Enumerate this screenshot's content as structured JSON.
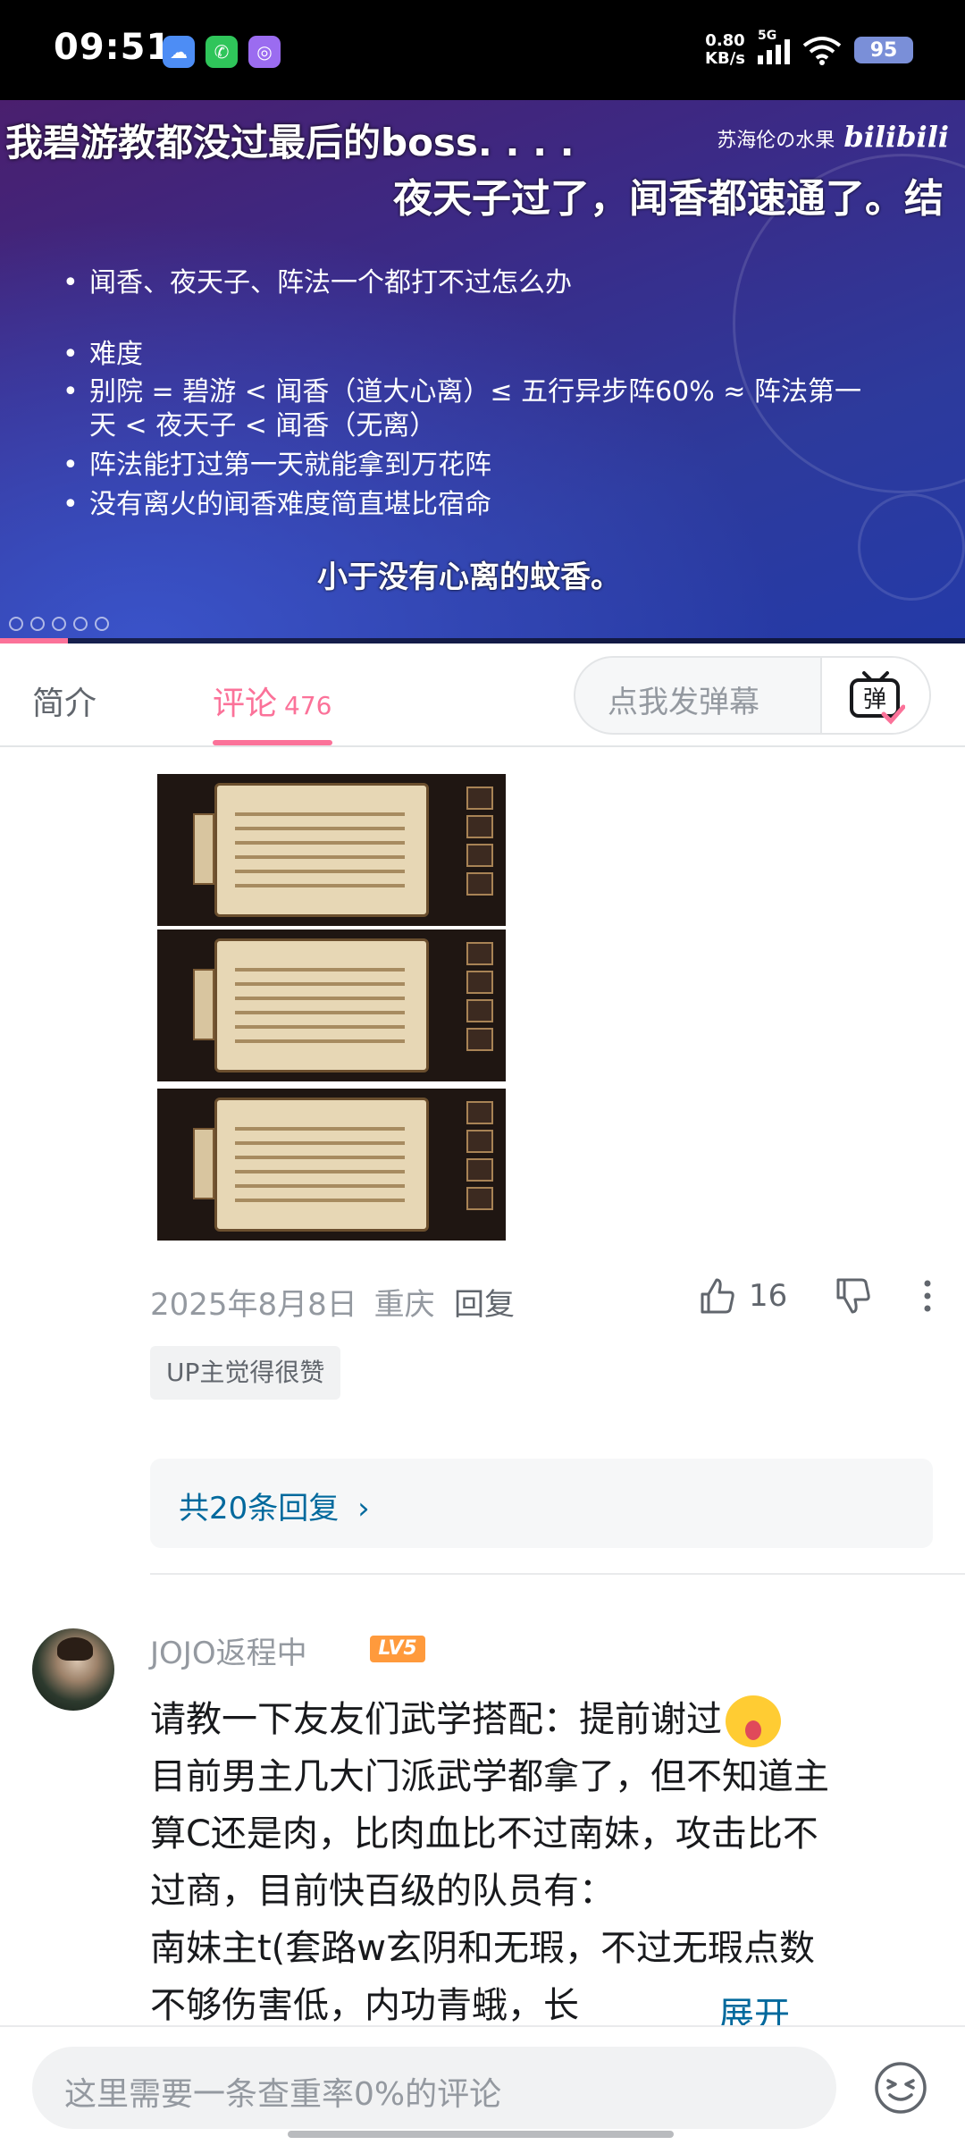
{
  "status_bar": {
    "time": "09:51",
    "net_speed_value": "0.80",
    "net_speed_unit": "KB/s",
    "network": "5G",
    "battery": "95",
    "icons": [
      "weather-cloud-icon",
      "phone-app-icon",
      "podcast-app-icon",
      "signal-icon",
      "wifi-icon",
      "battery-icon"
    ]
  },
  "video": {
    "subtitle_top": "我碧游教都没过最后的boss. . . .",
    "watermark_author": "苏海伦の水果",
    "watermark_brand": "bilibili",
    "subtitle_second": "夜天子过了，闻香都速通了。结",
    "slide_bullets": [
      "闻香、夜天子、阵法一个都打不过怎么办",
      "难度",
      "别院 = 碧游 < 闻香（道大心离）≤ 五行异步阵60% ≈ 阵法第一天 < 夜天子 < 闻香（无离）",
      "阵法能打过第一天就能拿到万花阵",
      "没有离火的闻香难度简直堪比宿命"
    ],
    "subtitle_bottom": "小于没有心离的蚊香。",
    "progress_fraction": 0.07
  },
  "tabs": {
    "intro_label": "简介",
    "comments_label": "评论",
    "comments_count": "476",
    "active": "comments"
  },
  "danmaku": {
    "placeholder": "点我发弹幕",
    "button_glyph": "弹"
  },
  "comment_1": {
    "image_count": 3,
    "date": "2025年8月8日",
    "location": "重庆",
    "reply_label": "回复",
    "likes": "16",
    "up_tag": "UP主觉得很赞",
    "replies_link": "共20条回复",
    "chevron": "›"
  },
  "comment_2": {
    "username": "JOJO返程中",
    "level": "LV5",
    "lines": [
      "请教一下友友们武学搭配：提前谢过",
      "目前男主几大门派武学都拿了，但不知道主",
      "算C还是肉，比肉血比不过南妹，攻击比不",
      "过商，目前快百级的队员有：",
      "南妹主t(套路w玄阴和无瑕，不过无瑕点数",
      "不够伤害低，内功青蛾，长"
    ],
    "expand_label": "展开"
  },
  "bottom_bar": {
    "input_placeholder": "这里需要一条查重率0%的评论"
  },
  "colors": {
    "accent_pink": "#fb7299",
    "link_blue": "#00699d",
    "level_orange": "#ff9a3c"
  }
}
